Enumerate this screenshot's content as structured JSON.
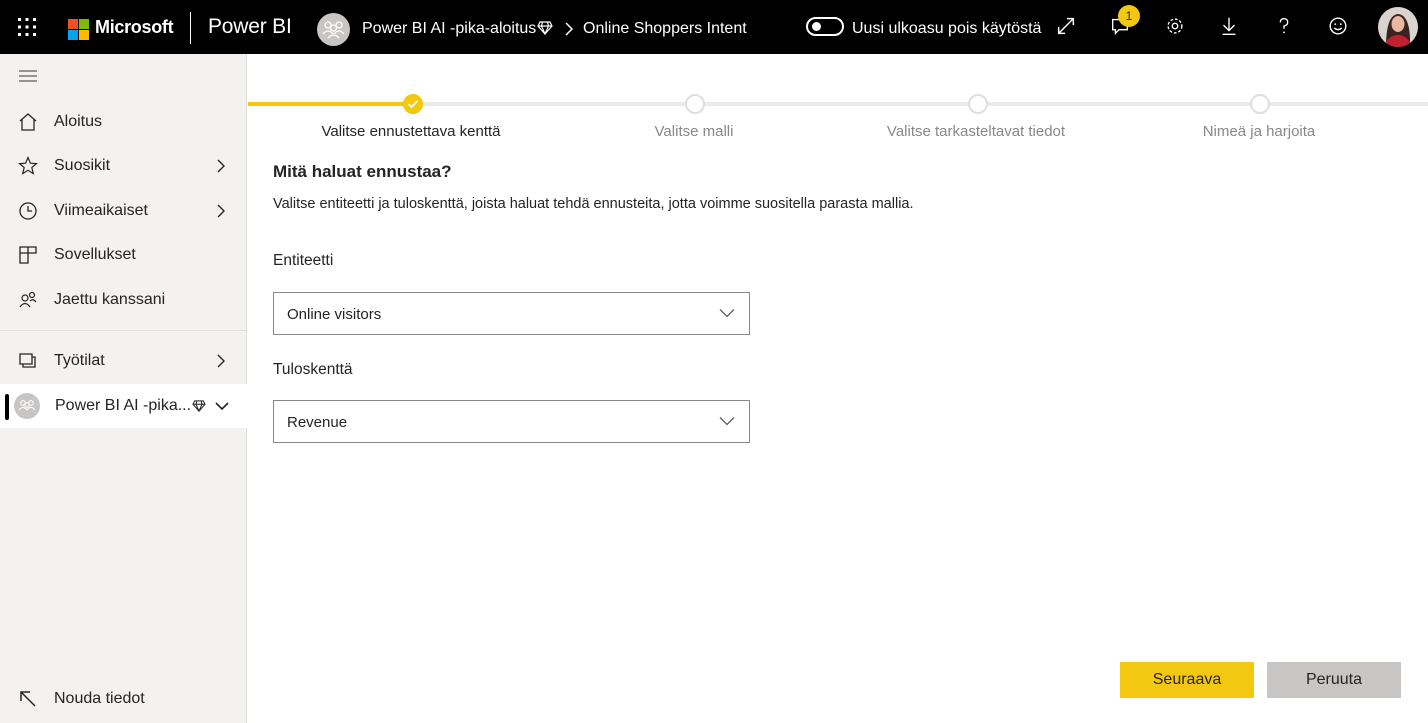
{
  "header": {
    "brand": "Microsoft",
    "product": "Power BI",
    "workspace_crumb": "Power BI AI -pika-aloitus",
    "dataset_crumb": "Online Shoppers Intent",
    "toggle_label": "Uusi ulkoasu pois käytöstä",
    "notification_count": "1",
    "icons": [
      "expand-icon",
      "notification-icon",
      "settings-icon",
      "download-icon",
      "help-icon",
      "feedback-icon"
    ]
  },
  "sidebar": {
    "items": [
      {
        "label": "Aloitus",
        "icon": "home-icon"
      },
      {
        "label": "Suosikit",
        "icon": "star-icon"
      },
      {
        "label": "Viimeaikaiset",
        "icon": "clock-icon"
      },
      {
        "label": "Sovellukset",
        "icon": "apps-icon"
      },
      {
        "label": "Jaettu kanssani",
        "icon": "shared-icon"
      },
      {
        "label": "Työtilat",
        "icon": "workspaces-icon"
      },
      {
        "label": "Power BI AI -pika...",
        "icon": "workspace-avatar"
      }
    ],
    "get_data": "Nouda tiedot"
  },
  "wizard": {
    "steps": [
      {
        "label": "Valitse ennustettava kenttä",
        "state": "completed"
      },
      {
        "label": "Valitse malli",
        "state": "pending"
      },
      {
        "label": "Valitse tarkasteltavat tiedot",
        "state": "pending"
      },
      {
        "label": "Nimeä ja harjoita",
        "state": "pending"
      }
    ],
    "title": "Mitä haluat ennustaa?",
    "description": "Valitse entiteetti ja tuloskenttä, joista haluat tehdä ennusteita, jotta voimme suositella parasta mallia.",
    "entity_label": "Entiteetti",
    "entity_value": "Online visitors",
    "outcome_label": "Tuloskenttä",
    "outcome_value": "Revenue",
    "next_button": "Seuraava",
    "cancel_button": "Peruuta"
  },
  "colors": {
    "accent": "#f2c811",
    "header_bg": "#000000",
    "sidebar_bg": "#f3f2f1"
  }
}
